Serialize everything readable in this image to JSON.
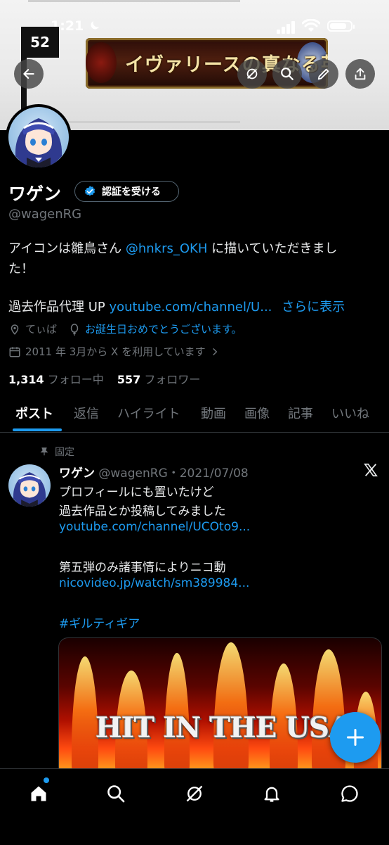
{
  "status_bar": {
    "time": "1:21",
    "battery_level": 0.85
  },
  "overlay_badge": "52",
  "banner": {
    "title": "イヴァリースの真なる英雄"
  },
  "profile": {
    "display_name": "ワゲン",
    "verify_button_label": "認証を受ける",
    "handle": "@wagenRG",
    "bio_line1_pre": "アイコンは雛鳥さん ",
    "bio_mention": "@hnkrs_OKH",
    "bio_line1_post": " に描いていただきまし",
    "bio_line2": "た！",
    "bio_line3_pre": "過去作品代理 UP ",
    "bio_link": "youtube.com/channel/U...",
    "more_label": "さらに表示",
    "location": "てぃば",
    "birthday": "お誕生日おめでとうございます。",
    "joined": "2011 年 3月から X を利用しています",
    "following_count": "1,314",
    "following_label": "フォロー中",
    "followers_count": "557",
    "followers_label": "フォロワー"
  },
  "tabs": [
    {
      "label": "ポスト"
    },
    {
      "label": "返信"
    },
    {
      "label": "ハイライト"
    },
    {
      "label": "動画"
    },
    {
      "label": "画像"
    },
    {
      "label": "記事"
    },
    {
      "label": "いいね"
    }
  ],
  "post": {
    "pinned_label": "固定",
    "name": "ワゲン",
    "handle_date": "@wagenRG・2021/07/08",
    "line1": "プロフィールにも置いたけど",
    "line2": "過去作品とか投稿してみました",
    "link1": "youtube.com/channel/UCOto9...",
    "line3": "第五弾のみ諸事情によりニコ動",
    "link2": "nicovideo.jp/watch/sm389984...",
    "hashtag": "#ギルティギア",
    "media_text": "HIT IN THE USA"
  },
  "nav": {
    "icons": [
      "home-icon",
      "search-icon",
      "grok-icon",
      "bell-icon",
      "messages-icon"
    ]
  },
  "colors": {
    "accent": "#1d9bf0",
    "muted": "#71767b",
    "background": "#000000"
  }
}
